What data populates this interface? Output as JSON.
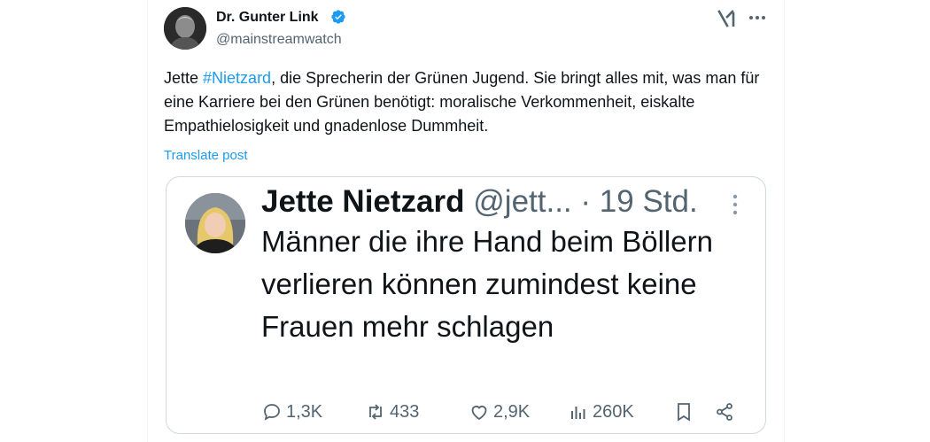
{
  "author": {
    "name": "Dr. Gunter Link",
    "handle": "@mainstreamwatch"
  },
  "tweet": {
    "text_prefix": "Jette ",
    "hashtag": "#Nietzard",
    "text_suffix": ", die Sprecherin der Grünen Jugend. Sie bringt alles mit, was man für eine Karriere bei den Grünen benötigt: moralische Verkommenheit, eiskalte Empathielosigkeit und gnadenlose Dummheit.",
    "translate_label": "Translate post"
  },
  "embedded": {
    "name": "Jette Nietzard",
    "handle": "@jett...",
    "time": "· 19 Std.",
    "text": "Männer die ihre Hand beim Böllern verlieren können zumindest keine Frauen mehr schlagen",
    "actions": {
      "replies": "1,3K",
      "retweets": "433",
      "likes": "2,9K",
      "views": "260K"
    }
  },
  "icons": {
    "verified": "verified-badge-icon",
    "app_logo": "xai-logo-icon",
    "more": "more-horizontal-icon",
    "reply": "reply-icon",
    "retweet": "retweet-icon",
    "like": "heart-icon",
    "views": "views-icon",
    "bookmark": "bookmark-icon",
    "share": "share-icon"
  },
  "colors": {
    "accent": "#1d9bf0",
    "muted": "#536471",
    "text": "#0f1419",
    "border": "#cfd9de"
  }
}
